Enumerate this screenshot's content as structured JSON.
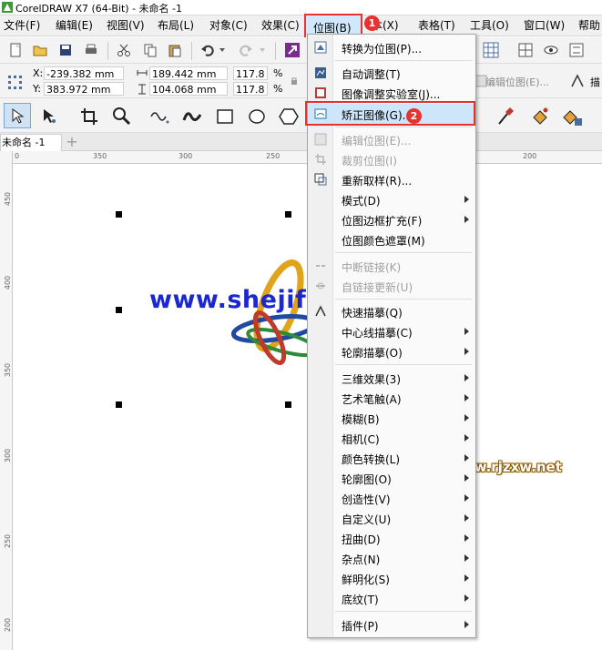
{
  "app": {
    "title": "CorelDRAW X7 (64-Bit) - 未命名 -1"
  },
  "menubar": {
    "items": [
      "文件(F)",
      "编辑(E)",
      "视图(V)",
      "布局(L)",
      "对象(C)",
      "效果(C)",
      "位图(B)",
      "本(X)",
      "表格(T)",
      "工具(O)",
      "窗口(W)",
      "帮助"
    ],
    "active": "位图(B)"
  },
  "badges": {
    "first": "1",
    "second": "2"
  },
  "propertybar": {
    "x_label": "X:",
    "x_value": "-239.382 mm",
    "y_label": "Y:",
    "y_value": "383.972 mm",
    "width": "189.442 mm",
    "height": "104.068 mm",
    "scale_x": "117.8",
    "scale_y": "117.8",
    "percent_x": "%",
    "percent_y": "%",
    "edit_bitmap": "编辑位图(E)...",
    "trace": "描"
  },
  "tabs": {
    "document": "未命名 -1",
    "add": "+"
  },
  "rulers": {
    "h_ticks": [
      "0",
      "350",
      "300",
      "250",
      "200"
    ],
    "v_ticks": [
      "450",
      "400",
      "350",
      "300",
      "250",
      "200"
    ]
  },
  "canvas": {
    "watermark1": "www.shejifuzhu.com",
    "watermark2": "www.rjzxw.net"
  },
  "dropdown": {
    "items": [
      {
        "label": "转换为位图(P)...",
        "icon": "convert-bitmap-icon",
        "submenu": false,
        "enabled": true
      },
      {
        "label": "自动调整(T)",
        "icon": "auto-adjust-icon",
        "submenu": false,
        "enabled": true
      },
      {
        "label": "图像调整实验室(J)...",
        "icon": "image-lab-icon",
        "submenu": false,
        "enabled": true
      },
      {
        "label": "矫正图像(G)...",
        "icon": "straighten-image-icon",
        "submenu": false,
        "enabled": true
      },
      {
        "label": "编辑位图(E)...",
        "icon": "edit-bitmap-icon",
        "submenu": false,
        "enabled": false
      },
      {
        "label": "裁剪位图(I)",
        "icon": "crop-bitmap-icon",
        "submenu": false,
        "enabled": false
      },
      {
        "label": "重新取样(R)...",
        "icon": "resample-icon",
        "submenu": false,
        "enabled": true
      },
      {
        "label": "模式(D)",
        "submenu": true,
        "enabled": true
      },
      {
        "label": "位图边框扩充(F)",
        "submenu": true,
        "enabled": true
      },
      {
        "label": "位图颜色遮罩(M)",
        "submenu": false,
        "enabled": true
      },
      {
        "label": "中断链接(K)",
        "icon": "break-link-icon",
        "submenu": false,
        "enabled": false
      },
      {
        "label": "自链接更新(U)",
        "icon": "update-link-icon",
        "submenu": false,
        "enabled": false
      },
      {
        "label": "快速描摹(Q)",
        "icon": "quick-trace-icon",
        "submenu": false,
        "enabled": true
      },
      {
        "label": "中心线描摹(C)",
        "submenu": true,
        "enabled": true
      },
      {
        "label": "轮廓描摹(O)",
        "submenu": true,
        "enabled": true
      },
      {
        "label": "三维效果(3)",
        "submenu": true,
        "enabled": true
      },
      {
        "label": "艺术笔触(A)",
        "submenu": true,
        "enabled": true
      },
      {
        "label": "模糊(B)",
        "submenu": true,
        "enabled": true
      },
      {
        "label": "相机(C)",
        "submenu": true,
        "enabled": true
      },
      {
        "label": "颜色转换(L)",
        "submenu": true,
        "enabled": true
      },
      {
        "label": "轮廓图(O)",
        "submenu": true,
        "enabled": true
      },
      {
        "label": "创造性(V)",
        "submenu": true,
        "enabled": true
      },
      {
        "label": "自定义(U)",
        "submenu": true,
        "enabled": true
      },
      {
        "label": "扭曲(D)",
        "submenu": true,
        "enabled": true
      },
      {
        "label": "杂点(N)",
        "submenu": true,
        "enabled": true
      },
      {
        "label": "鲜明化(S)",
        "submenu": true,
        "enabled": true
      },
      {
        "label": "底纹(T)",
        "submenu": true,
        "enabled": true
      },
      {
        "label": "插件(P)",
        "submenu": true,
        "enabled": true
      }
    ]
  },
  "colors": {
    "highlight": "#e8322f",
    "menu_hover": "#cde6fb",
    "watermark_blue": "#1a27d2"
  }
}
